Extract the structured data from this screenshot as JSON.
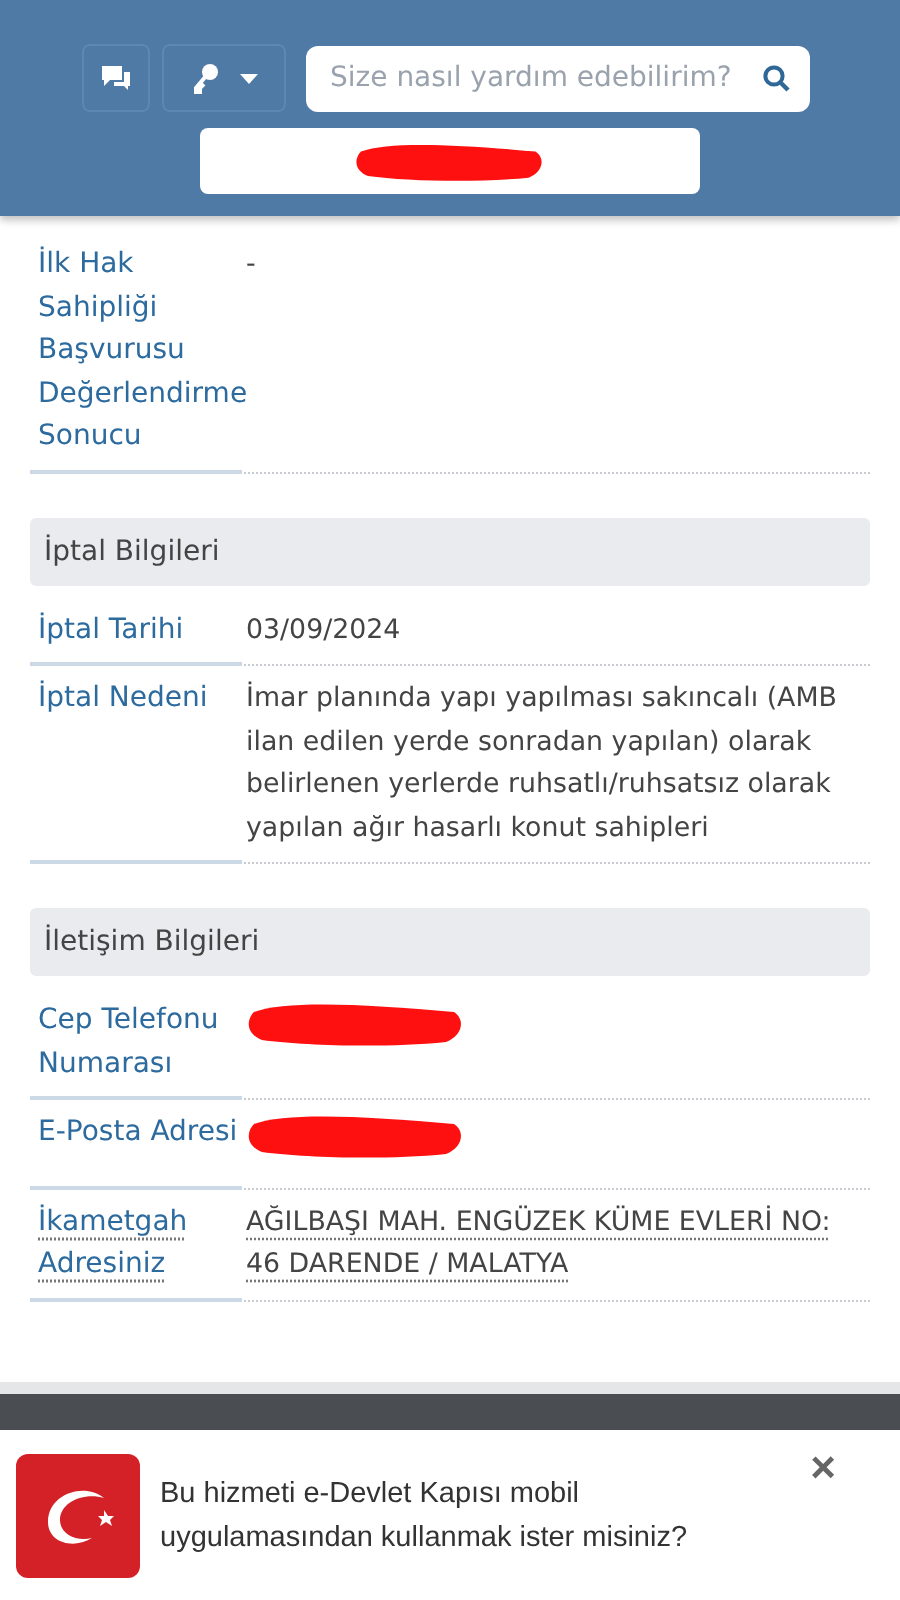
{
  "header": {
    "search": {
      "placeholder": "Size nasıl yardım edebilirim?"
    }
  },
  "sections": [
    {
      "rows": [
        {
          "kind": "text",
          "label": "İlk Hak Sahipliği Başvurusu Değerlendirme Sonucu",
          "value": "-"
        }
      ]
    },
    {
      "title": "İptal Bilgileri",
      "rows": [
        {
          "kind": "text",
          "label": "İptal Tarihi",
          "value": "03/09/2024"
        },
        {
          "kind": "text",
          "label": "İptal Nedeni",
          "value": "İmar planında yapı yapılması sakıncalı (AMB ilan edilen yerde sonradan yapılan) olarak belirlenen yerlerde ruhsatlı/ruhsatsız olarak yapılan ağır hasarlı konut sahipleri"
        }
      ]
    },
    {
      "title": "İletişim Bilgileri",
      "rows": [
        {
          "kind": "redacted",
          "label": "Cep Telefonu Numarası"
        },
        {
          "kind": "redacted",
          "label": "E-Posta Adresi"
        },
        {
          "kind": "link",
          "label": "İkametgah Adresiniz",
          "value": "AĞILBAŞI MAH. ENGÜZEK KÜME EVLERİ NO: 46 DARENDE / MALATYA"
        }
      ]
    }
  ],
  "banner": {
    "message": "Bu hizmeti e-Devlet Kapısı mobil uygulamasından kullanmak ister misiniz?",
    "close": "×"
  }
}
